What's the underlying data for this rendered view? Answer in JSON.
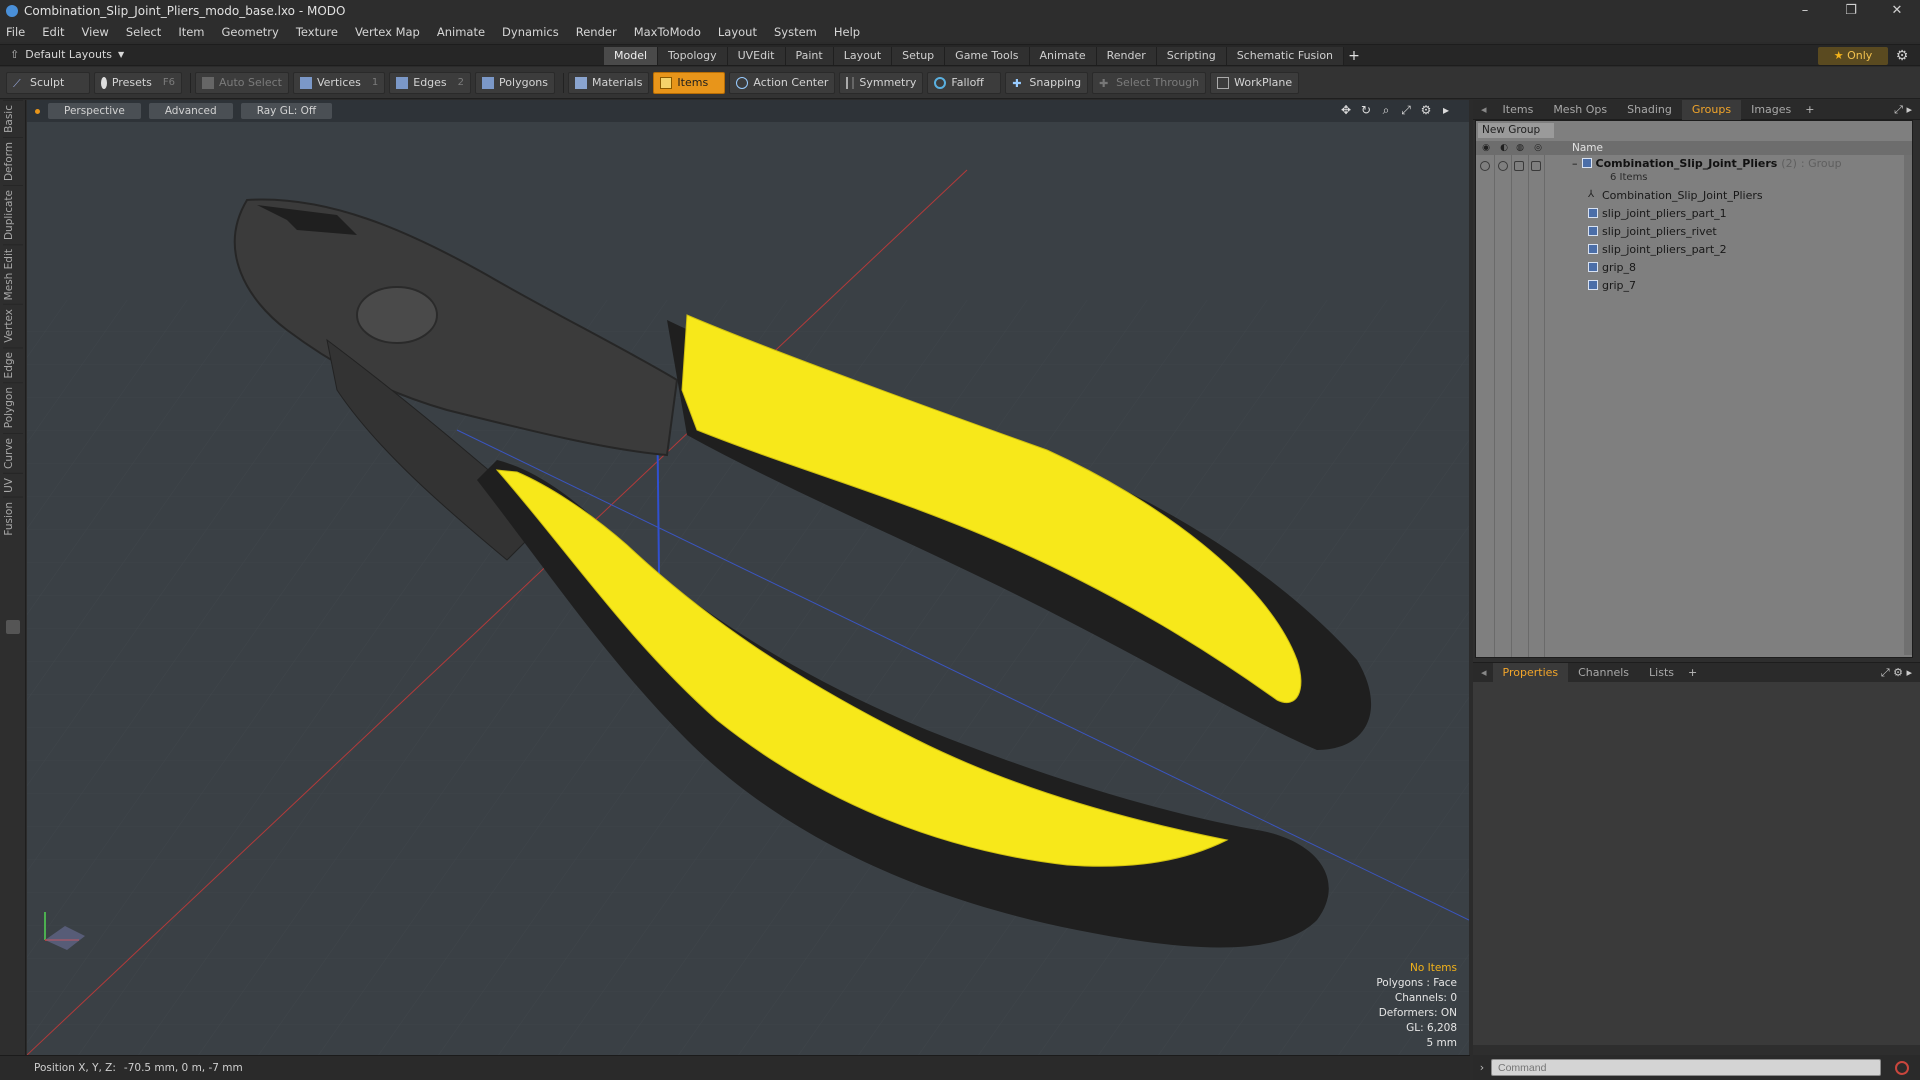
{
  "window": {
    "title": "Combination_Slip_Joint_Pliers_modo_base.lxo - MODO",
    "controls": [
      "–",
      "❐",
      "✕"
    ]
  },
  "menu": [
    "File",
    "Edit",
    "View",
    "Select",
    "Item",
    "Geometry",
    "Texture",
    "Vertex Map",
    "Animate",
    "Dynamics",
    "Render",
    "MaxToModo",
    "Layout",
    "System",
    "Help"
  ],
  "layoutbar": {
    "layouts_label": "Default Layouts",
    "tabs": [
      "Model",
      "Topology",
      "UVEdit",
      "Paint",
      "Layout",
      "Setup",
      "Game Tools",
      "Animate",
      "Render",
      "Scripting",
      "Schematic Fusion"
    ],
    "active_tab": "Model",
    "plus": "+",
    "only_label": "Only"
  },
  "toolbar": {
    "sculpt": "Sculpt",
    "presets": "Presets",
    "presets_key": "F6",
    "auto_select": "Auto Select",
    "vertices": "Vertices",
    "vertices_key": "1",
    "edges": "Edges",
    "edges_key": "2",
    "polygons": "Polygons",
    "materials": "Materials",
    "items": "Items",
    "action_center": "Action Center",
    "symmetry": "Symmetry",
    "falloff": "Falloff",
    "snapping": "Snapping",
    "select_through": "Select Through",
    "workplane": "WorkPlane"
  },
  "left_strip": [
    "Basic",
    "Deform",
    "Duplicate",
    "Mesh Edit",
    "Vertex",
    "Edge",
    "Polygon",
    "Curve",
    "UV",
    "Fusion"
  ],
  "viewport": {
    "view_mode": "Perspective",
    "shading": "Advanced",
    "raygl": "Ray GL: Off",
    "stats": {
      "selection": "No Items",
      "polygons": "Polygons : Face",
      "channels": "Channels: 0",
      "deformers": "Deformers: ON",
      "gl": "GL: 6,208",
      "grid": "5 mm"
    }
  },
  "status": {
    "position_label": "Position X, Y, Z:",
    "position_value": "-70.5 mm, 0 m, -7 mm"
  },
  "right_panel": {
    "tabs": [
      "Items",
      "Mesh Ops",
      "Shading",
      "Groups",
      "Images"
    ],
    "active_tab": "Groups",
    "plus": "+",
    "new_group": "New Group",
    "name_header": "Name",
    "group": {
      "name": "Combination_Slip_Joint_Pliers",
      "count": "(2)",
      "type": ": Group",
      "items_label": "6 Items"
    },
    "children": [
      "Combination_Slip_Joint_Pliers",
      "slip_joint_pliers_part_1",
      "slip_joint_pliers_rivet",
      "slip_joint_pliers_part_2",
      "grip_8",
      "grip_7"
    ],
    "props_tabs": [
      "Properties",
      "Channels",
      "Lists"
    ],
    "props_active": "Properties",
    "command_placeholder": "Command"
  },
  "colors": {
    "accent_orange": "#e8951a",
    "grip_yellow": "#f7e81a",
    "viewport_bg": "#3a4045"
  }
}
